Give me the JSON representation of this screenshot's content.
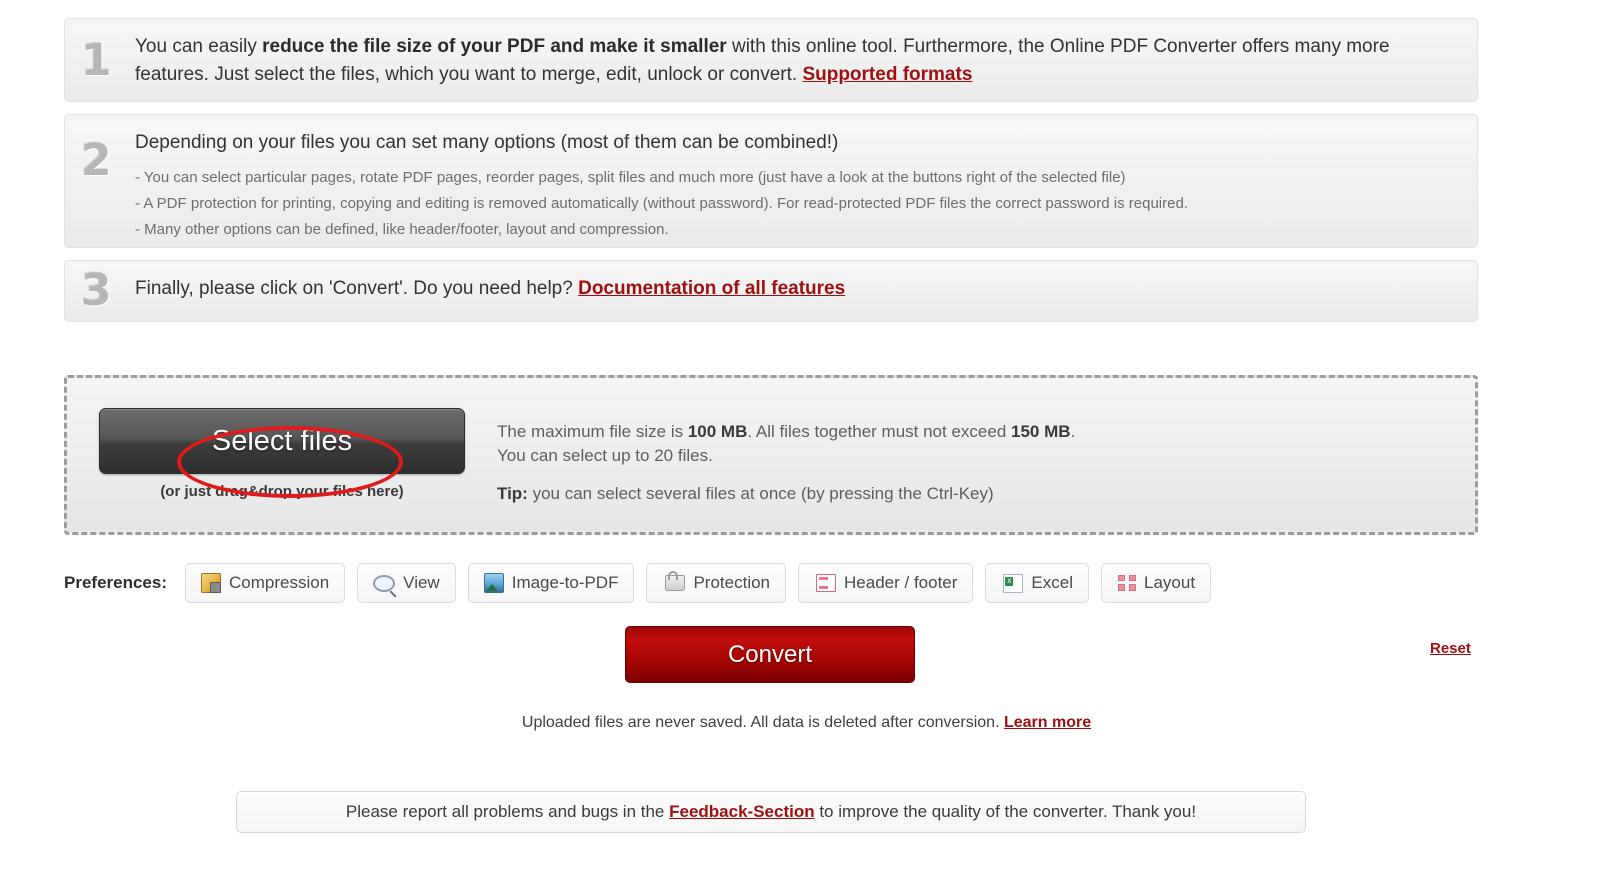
{
  "steps": [
    {
      "number": "1",
      "text_before": "You can easily ",
      "bold": "reduce the file size of your PDF and make it smaller",
      "text_after": " with this online tool. Furthermore, the Online PDF Converter offers many more features. Just select the files, which you want to merge, edit, unlock or convert. ",
      "link": "Supported formats"
    },
    {
      "number": "2",
      "text": "Depending on your files you can set many options (most of them can be combined!)",
      "bullets": [
        "- You can select particular pages, rotate PDF pages, reorder pages, split files and much more (just have a look at the buttons right of the selected file)",
        "- A PDF protection for printing, copying and editing is removed automatically (without password). For read-protected PDF files the correct password is required.",
        "- Many other options can be defined, like header/footer, layout and compression."
      ]
    },
    {
      "number": "3",
      "text": "Finally, please click on 'Convert'. Do you need help? ",
      "link": "Documentation of all features"
    }
  ],
  "dropzone": {
    "select_button_label": "Select files",
    "drag_note": "(or just drag&drop your files here)",
    "limit_line1_a": "The maximum file size is ",
    "limit_line1_max": "100 MB",
    "limit_line1_b": ". All files together must not exceed ",
    "limit_line1_total": "150 MB",
    "limit_line1_c": ".",
    "limit_line2": "You can select up to 20 files.",
    "tip_label": "Tip:",
    "tip_text": " you can select several files at once (by pressing the Ctrl-Key)",
    "annotation": "red-ellipse-highlight"
  },
  "preferences": {
    "label": "Preferences:",
    "buttons": [
      {
        "label": "Compression",
        "icon": "compression-icon"
      },
      {
        "label": "View",
        "icon": "magnifier-icon"
      },
      {
        "label": "Image-to-PDF",
        "icon": "image-icon"
      },
      {
        "label": "Protection",
        "icon": "lock-icon"
      },
      {
        "label": "Header / footer",
        "icon": "document-header-footer-icon"
      },
      {
        "label": "Excel",
        "icon": "excel-file-icon"
      },
      {
        "label": "Layout",
        "icon": "layout-grid-icon"
      }
    ]
  },
  "actions": {
    "convert_label": "Convert",
    "reset_label": "Reset"
  },
  "privacy": {
    "text": "Uploaded files are never saved. All data is deleted after conversion. ",
    "link": "Learn more"
  },
  "feedback": {
    "text_before": "Please report all problems and bugs in the ",
    "link": "Feedback-Section",
    "text_after": " to improve the quality of the converter. Thank you!"
  },
  "colors": {
    "accent_red": "#9e1010",
    "convert_red": "#c20d0d",
    "annotation_red": "#e01b1b",
    "panel_bg": "#f1f1f1",
    "step_number_gray": "#b6b6b6"
  }
}
